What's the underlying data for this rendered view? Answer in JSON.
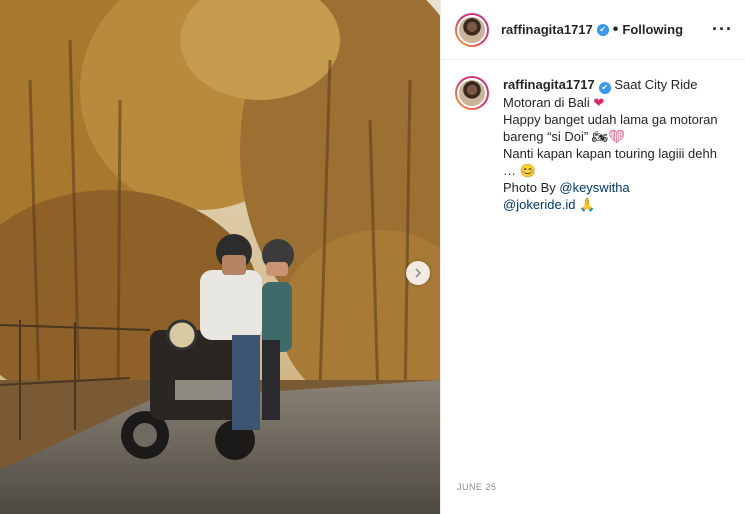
{
  "post": {
    "username": "raffinagita1717",
    "verified_mark": "✔",
    "separator": "•",
    "follow_status": "Following",
    "more_label": "···",
    "next_arrow": "›",
    "caption": {
      "username": "raffinagita1717",
      "first_line_text": " Saat City Ride",
      "line2_text": "Motoran di Bali ",
      "line2_emoji": "❤",
      "line3_text": "Happy banget udah lama ga motoran",
      "line4_text": "bareng “si Doi” ",
      "line4_emoji_1": "🏍",
      "line4_emoji_2": "❤",
      "line5_text": "Nanti kapan kapan touring lagiii dehh",
      "line6_text": "… ",
      "line6_emoji": "😊",
      "photo_by_label": "Photo By ",
      "mention_1": "@keyswitha",
      "mention_2": "@jokeride.id",
      "mention_2_emoji": "🙏"
    },
    "date": "JUNE 25"
  },
  "icons": {
    "verified": "verified-badge-icon",
    "next": "chevron-right-icon",
    "more": "more-options-icon"
  },
  "colors": {
    "verified": "#3897f0",
    "mention": "#00376b",
    "heart": "#e0245e",
    "story_ring": "#e1306c"
  }
}
